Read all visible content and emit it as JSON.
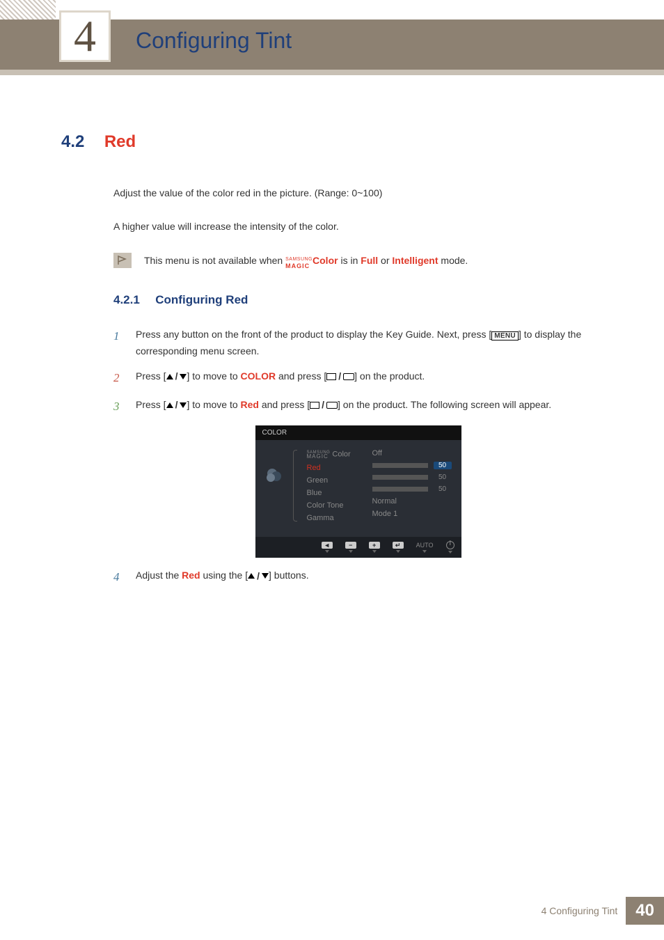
{
  "header": {
    "chapter_number": "4",
    "chapter_title": "Configuring Tint"
  },
  "section": {
    "number": "4.2",
    "title": "Red",
    "intro1": "Adjust the value of the color red in the picture. (Range: 0~100)",
    "intro2": "A higher value will increase the intensity of the color.",
    "note_pre": "This menu is not available when ",
    "note_magic_top": "SAMSUNG",
    "note_magic_bot": "MAGIC",
    "note_magic_suffix": "Color",
    "note_mid1": " is in ",
    "note_full": "Full",
    "note_mid2": " or ",
    "note_intelligent": "Intelligent",
    "note_post": " mode."
  },
  "subsection": {
    "number": "4.2.1",
    "title": "Configuring Red"
  },
  "steps": {
    "s1": {
      "num": "1",
      "text_a": "Press any button on the front of the product to display the Key Guide. Next, press [",
      "menu": "MENU",
      "text_b": "] to display the corresponding menu screen."
    },
    "s2": {
      "num": "2",
      "text_a": "Press [",
      "text_b": "] to move to ",
      "color": "COLOR",
      "text_c": " and press [",
      "text_d": "] on the product."
    },
    "s3": {
      "num": "3",
      "text_a": "Press [",
      "text_b": "] to move to ",
      "red": "Red",
      "text_c": " and press [",
      "text_d": "] on the product. The following screen will appear."
    },
    "s4": {
      "num": "4",
      "text_a": "Adjust the ",
      "red": "Red",
      "text_b": " using the [",
      "text_c": "] buttons."
    }
  },
  "osd": {
    "title": "COLOR",
    "items": {
      "magic_top": "SAMSUNG",
      "magic_bot": "MAGIC",
      "magic_label": " Color",
      "red": "Red",
      "green": "Green",
      "blue": "Blue",
      "color_tone": "Color Tone",
      "gamma": "Gamma"
    },
    "values": {
      "off": "Off",
      "red_val": "50",
      "green_val": "50",
      "blue_val": "50",
      "normal": "Normal",
      "mode1": "Mode 1"
    },
    "footer": {
      "auto": "AUTO"
    }
  },
  "footer": {
    "label": "4 Configuring Tint",
    "page": "40"
  }
}
